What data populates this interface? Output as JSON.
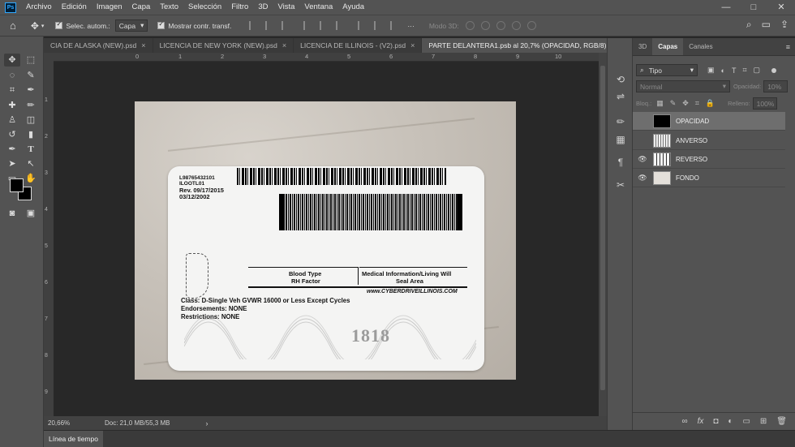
{
  "app": {
    "logo": "Ps"
  },
  "menu": [
    "Archivo",
    "Edición",
    "Imagen",
    "Capa",
    "Texto",
    "Selección",
    "Filtro",
    "3D",
    "Vista",
    "Ventana",
    "Ayuda"
  ],
  "window_controls": [
    "—",
    "□",
    "✕"
  ],
  "options": {
    "auto_select_label": "Selec. autom.:",
    "auto_select_value": "Capa",
    "show_transform_label": "Mostrar contr. transf.",
    "mode3d_label": "Modo 3D:"
  },
  "tabs": [
    {
      "label": "CIA DE ALASKA (NEW).psd"
    },
    {
      "label": "LICENCIA DE NEW YORK (NEW).psd"
    },
    {
      "label": "LICENCIA DE ILLINOIS - (V2).psd"
    },
    {
      "label": "PARTE DELANTERA1.psb al 20,7% (OPACIDAD, RGB/8) *"
    }
  ],
  "ruler": {
    "ticks": [
      "0",
      "1",
      "2",
      "3",
      "4",
      "5",
      "6",
      "7",
      "8",
      "9",
      "10",
      "11",
      "12"
    ]
  },
  "ruler_v": {
    "ticks": [
      "1",
      "2",
      "3",
      "4",
      "5",
      "6",
      "7",
      "8",
      "9"
    ]
  },
  "card": {
    "id_number": "L98765432101",
    "code": "ILOOTL01",
    "rev": "Rev. 09/17/2015",
    "date": "03/12/2002",
    "blood_type": "Blood Type",
    "rh_factor": "RH Factor",
    "medical_info": "Medical Information/Living Will",
    "seal_area": "Seal Area",
    "website": "www.CYBERDRIVEILLINOIS.COM",
    "class": "Class: D-Single Veh GVWR 16000 or Less Except Cycles",
    "endorsements": "Endorsements: NONE",
    "restrictions": "Restrictions: NONE",
    "seal_number": "1818"
  },
  "status": {
    "zoom": "20,66%",
    "doc": "Doc: 21,0 MB/55,3 MB"
  },
  "timeline": {
    "label": "Línea de tiempo"
  },
  "panel": {
    "tabs": [
      "3D",
      "Capas",
      "Canales"
    ],
    "filter_label": "Tipo",
    "blend_mode": "Normal",
    "opacity_label": "Opacidad:",
    "opacity_value": "10%",
    "lock_label": "Bloq.:",
    "fill_label": "Relleno:",
    "fill_value": "100%",
    "layers": [
      {
        "name": "OPACIDAD",
        "visible": false,
        "selected": true
      },
      {
        "name": "ANVERSO",
        "visible": false,
        "selected": false
      },
      {
        "name": "REVERSO",
        "visible": true,
        "selected": false
      },
      {
        "name": "FONDO",
        "visible": true,
        "selected": false
      }
    ]
  }
}
